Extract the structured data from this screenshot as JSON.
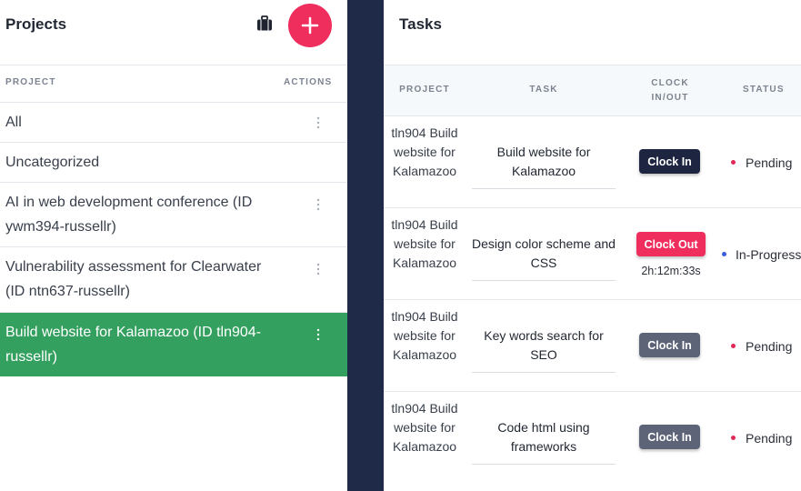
{
  "projects_panel": {
    "title": "Projects",
    "columns": {
      "project": "PROJECT",
      "actions": "ACTIONS"
    },
    "items": [
      {
        "label": "All",
        "has_actions": true,
        "selected": false
      },
      {
        "label": "Uncategorized",
        "has_actions": false,
        "selected": false
      },
      {
        "label": "AI in web development conference (ID ywm394-russellr)",
        "has_actions": true,
        "selected": false
      },
      {
        "label": "Vulnerability assessment for Clearwater (ID ntn637-russellr)",
        "has_actions": true,
        "selected": false
      },
      {
        "label": "Build website for Kalamazoo (ID tln904-russellr)",
        "has_actions": true,
        "selected": true
      }
    ]
  },
  "tasks_panel": {
    "title": "Tasks",
    "columns": {
      "project": "PROJECT",
      "task": "TASK",
      "clock": "CLOCK IN/OUT",
      "status": "STATUS"
    },
    "rows": [
      {
        "project": "tln904 Build website for Kalamazoo",
        "task": "Build website for Kalamazoo",
        "button": "Clock In",
        "button_style": "dark",
        "timer": "",
        "status": "Pending",
        "status_color": "#e02a55"
      },
      {
        "project": "tln904 Build website for Kalamazoo",
        "task": "Design color scheme and CSS",
        "button": "Clock Out",
        "button_style": "red",
        "timer": "2h:12m:33s",
        "status": "In-Progress",
        "status_color": "#3d5bd9"
      },
      {
        "project": "tln904 Build website for Kalamazoo",
        "task": "Key words search for SEO",
        "button": "Clock In",
        "button_style": "grey",
        "timer": "",
        "status": "Pending",
        "status_color": "#e02a55"
      },
      {
        "project": "tln904 Build website for Kalamazoo",
        "task": "Code html using frameworks",
        "button": "Clock In",
        "button_style": "grey",
        "timer": "",
        "status": "Pending",
        "status_color": "#e02a55"
      }
    ]
  },
  "colors": {
    "accent_red": "#f02e5d",
    "selected_green": "#34a05f",
    "divider_navy": "#1e2a48"
  },
  "icons": {
    "briefcase": "briefcase-icon",
    "add": "plus-icon",
    "menu": "kebab-menu-icon"
  }
}
